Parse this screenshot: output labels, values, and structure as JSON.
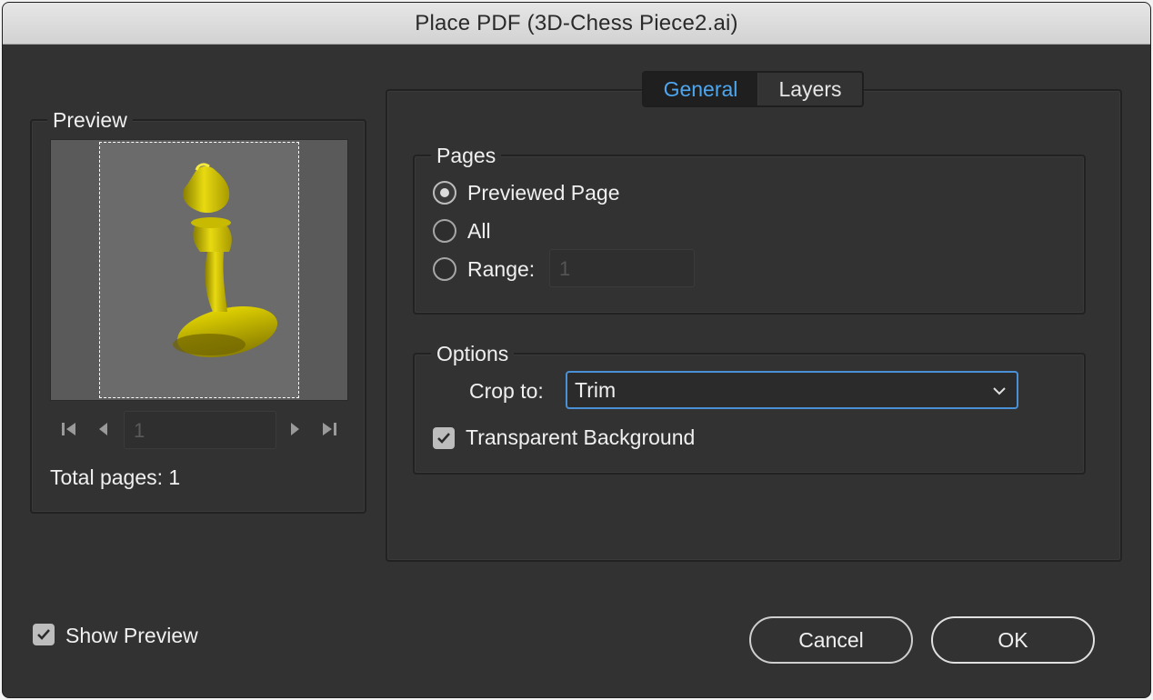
{
  "window": {
    "title": "Place PDF (3D-Chess Piece2.ai)"
  },
  "preview": {
    "legend": "Preview",
    "page_number": "1",
    "total_pages_label": "Total pages: 1",
    "nav": [
      "first-page-icon",
      "previous-page-icon",
      "next-page-icon",
      "last-page-icon"
    ]
  },
  "tabs": [
    {
      "label": "General",
      "active": true
    },
    {
      "label": "Layers",
      "active": false
    }
  ],
  "pages": {
    "legend": "Pages",
    "options": [
      {
        "label": "Previewed Page",
        "checked": true
      },
      {
        "label": "All",
        "checked": false
      },
      {
        "label": "Range:",
        "checked": false
      }
    ],
    "range_value": "1"
  },
  "options": {
    "legend": "Options",
    "crop_label": "Crop to:",
    "crop_value": "Trim",
    "transparent_background": {
      "label": "Transparent Background",
      "checked": true
    }
  },
  "footer": {
    "show_preview": {
      "label": "Show Preview",
      "checked": true
    },
    "cancel_label": "Cancel",
    "ok_label": "OK"
  },
  "colors": {
    "accent": "#4ea6ef",
    "focus": "#4a90d6",
    "piece": "#d4c400"
  }
}
